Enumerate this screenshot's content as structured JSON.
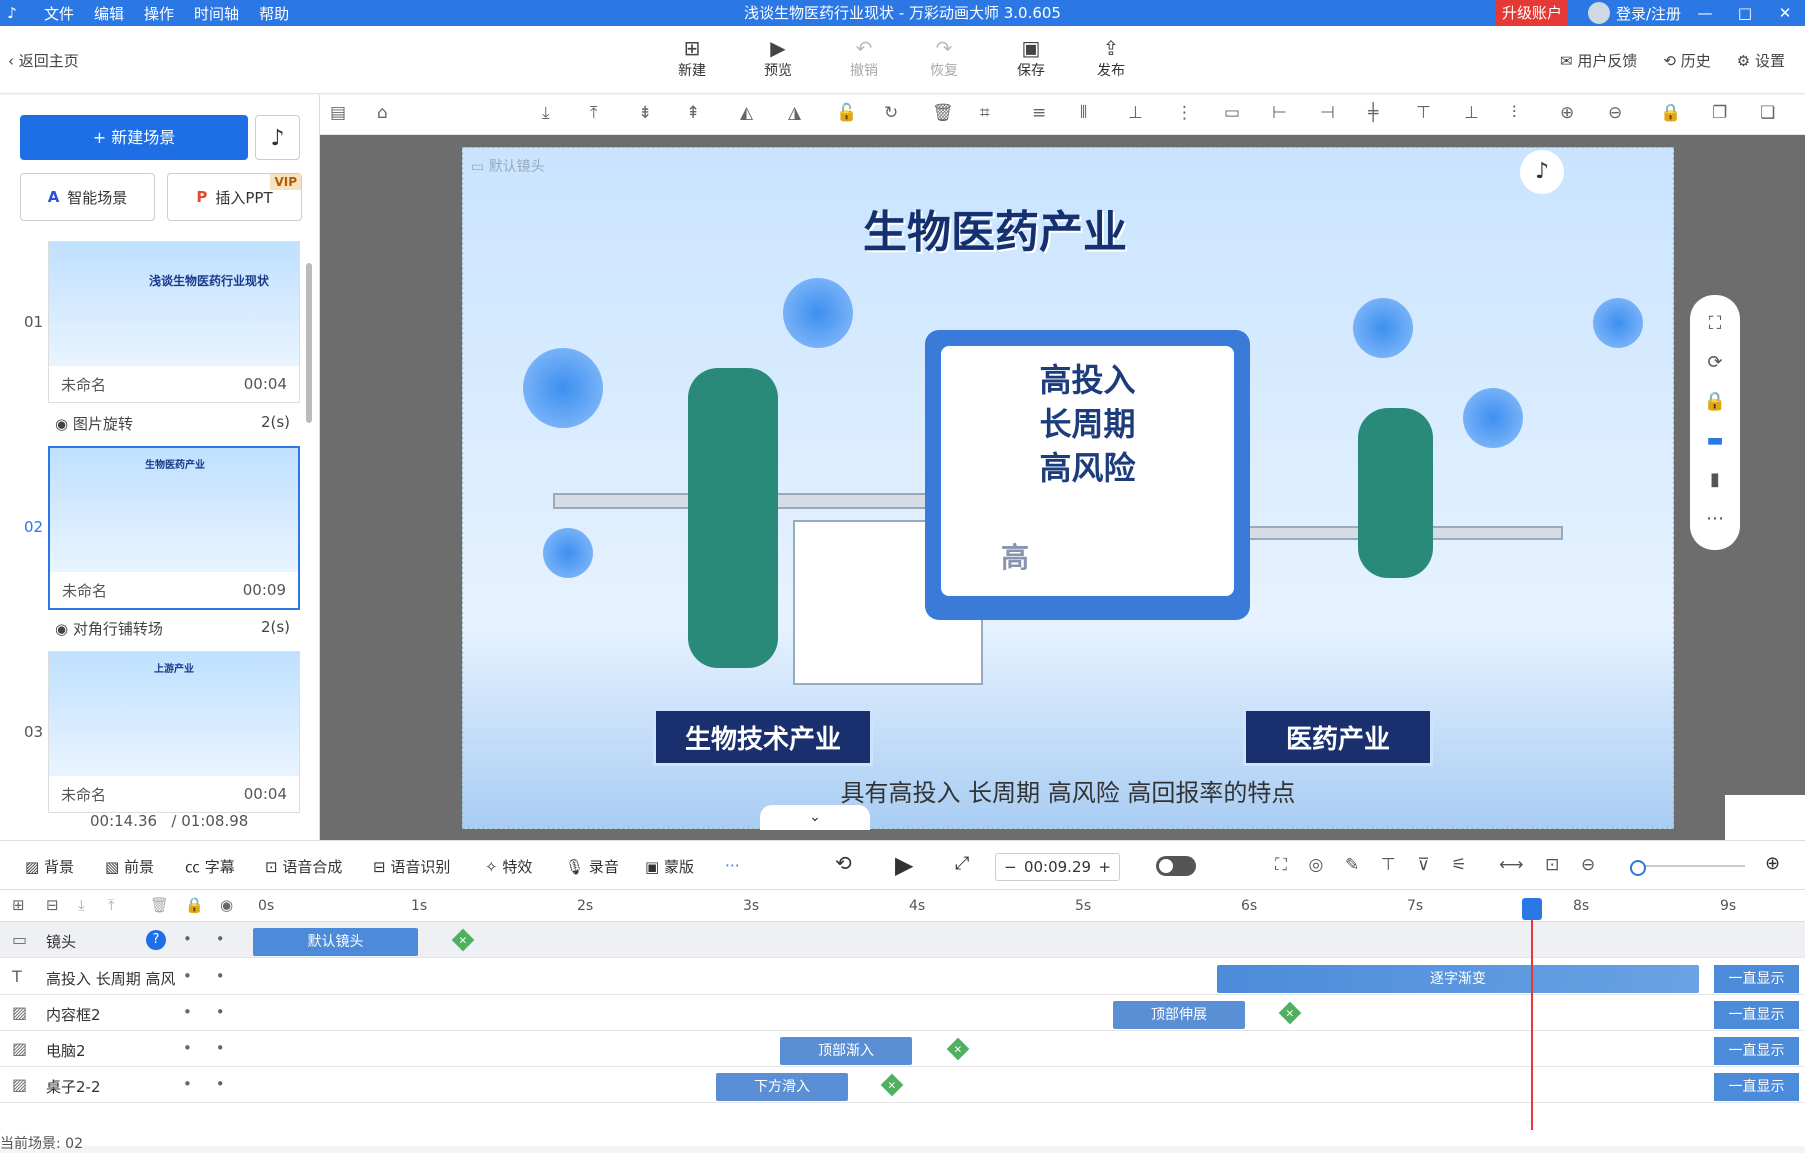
{
  "app": {
    "title": "浅谈生物医药行业现状 - 万彩动画大师 3.0.605",
    "menu": [
      "文件",
      "编辑",
      "操作",
      "时间轴",
      "帮助"
    ],
    "upgrade": "升级账户",
    "login": "登录/注册"
  },
  "toolbar": {
    "back": "返回主页",
    "buttons": [
      {
        "label": "新建",
        "icon": "plus-square-icon"
      },
      {
        "label": "预览",
        "icon": "play-icon"
      },
      {
        "label": "撤销",
        "icon": "undo-icon"
      },
      {
        "label": "恢复",
        "icon": "redo-icon"
      },
      {
        "label": "保存",
        "icon": "save-icon"
      },
      {
        "label": "发布",
        "icon": "publish-icon"
      }
    ],
    "right": [
      "用户反馈",
      "历史",
      "设置"
    ]
  },
  "sidebar": {
    "new_scene": "+ 新建场景",
    "smart_scene": "智能场景",
    "insert_ppt": "插入PPT",
    "vip": "VIP",
    "scenes": [
      {
        "num": "01",
        "name": "未命名",
        "time": "00:04",
        "thumb_text": "浅谈生物医药行业现状"
      },
      {
        "num": "02",
        "name": "未命名",
        "time": "00:09",
        "thumb_text": "生物医药产业"
      },
      {
        "num": "03",
        "name": "未命名",
        "time": "00:04",
        "thumb_text": "上游产业"
      }
    ],
    "transitions": [
      {
        "label": "图片旋转",
        "dur": "2(s)"
      },
      {
        "label": "对角行铺转场",
        "dur": "2(s)"
      }
    ],
    "current_time": "00:14.36",
    "total_time": "/ 01:08.98"
  },
  "stage": {
    "camera_label": "默认镜头",
    "title": "生物医药产业",
    "panel_lines": [
      "高投入",
      "长周期",
      "高风险"
    ],
    "panel_ghost": "高",
    "banner_left": "生物技术产业",
    "banner_right": "医药产业",
    "subtitle": "具有高投入  长周期  高风险  高回报率的特点"
  },
  "tltools": {
    "items": [
      "背景",
      "前景",
      "字幕",
      "语音合成",
      "语音识别",
      "特效",
      "录音",
      "蒙版"
    ],
    "time": "00:09.29"
  },
  "timeline": {
    "ticks": [
      "0s",
      "1s",
      "2s",
      "3s",
      "4s",
      "5s",
      "6s",
      "7s",
      "8s",
      "9s"
    ],
    "tracks": [
      {
        "label": "镜头",
        "clip": "默认镜头"
      },
      {
        "label": "高投入 长周期 高风",
        "clip": "逐字渐变",
        "always": "一直显示"
      },
      {
        "label": "内容框2",
        "clip": "顶部伸展",
        "always": "一直显示"
      },
      {
        "label": "电脑2",
        "clip": "顶部渐入",
        "always": "一直显示"
      },
      {
        "label": "桌子2-2",
        "clip": "下方滑入",
        "always": "一直显示"
      }
    ],
    "current_scene": "当前场景: 02"
  }
}
